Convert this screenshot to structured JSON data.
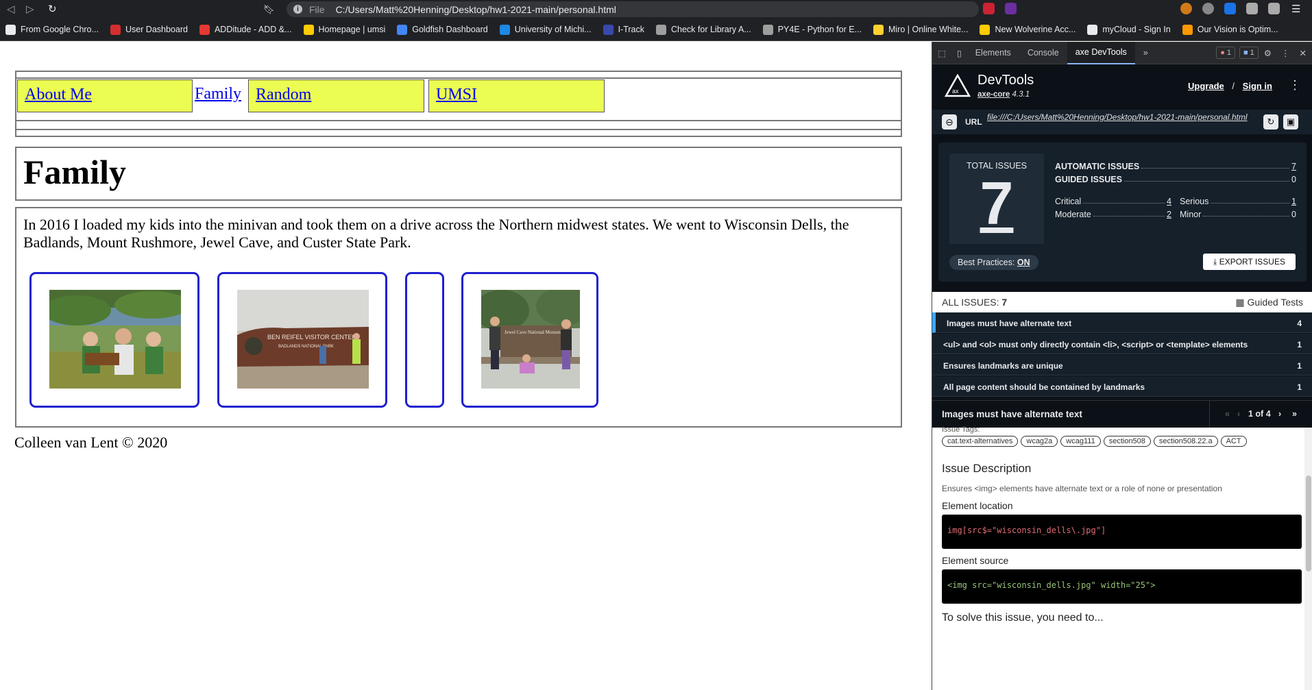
{
  "browser": {
    "address_scheme": "File",
    "address_path": "C:/Users/Matt%20Henning/Desktop/hw1-2021-main/personal.html",
    "bookmarks": [
      {
        "label": "From Google Chro...",
        "color": "#e8eaed"
      },
      {
        "label": "User Dashboard",
        "color": "#d32f2f"
      },
      {
        "label": "ADDitude - ADD &...",
        "color": "#e53935"
      },
      {
        "label": "Homepage | umsi",
        "color": "#ffcb05"
      },
      {
        "label": "Goldfish Dashboard",
        "color": "#4285f4"
      },
      {
        "label": "University of Michi...",
        "color": "#1e88e5"
      },
      {
        "label": "I-Track",
        "color": "#3949ab"
      },
      {
        "label": "Check for Library A...",
        "color": "#9e9e9e"
      },
      {
        "label": "PY4E - Python for E...",
        "color": "#9e9e9e"
      },
      {
        "label": "Miro | Online White...",
        "color": "#ffd02f"
      },
      {
        "label": "New Wolverine Acc...",
        "color": "#ffcb05"
      },
      {
        "label": "myCloud - Sign In",
        "color": "#e8eaed"
      },
      {
        "label": "Our Vision is Optim...",
        "color": "#ff9800"
      }
    ]
  },
  "page": {
    "nav": {
      "about": "About Me",
      "family": "Family",
      "random": "Random",
      "umsi": "UMSI"
    },
    "heading": "Family",
    "paragraph": "In 2016 I loaded my kids into the minivan and took them on a drive across the Northern midwest states. We went to Wisconsin Dells, the Badlands, Mount Rushmore, Jewel Cave, and Custer State Park.",
    "footer": "Colleen van Lent © 2020",
    "photo_sign_2": "BEN REIFEL VISITOR CENTER",
    "photo_sign_2b": "BADLANDS NATIONAL PARK",
    "photo_sign_4": "Jewel Cave National Monument"
  },
  "devtools": {
    "tabs": [
      "Elements",
      "Console",
      "axe DevTools"
    ],
    "error_count": "1",
    "message_count": "1",
    "title": "DevTools",
    "core_link": "axe-core",
    "core_version": "4.3.1",
    "upgrade": "Upgrade",
    "slash": "/",
    "sign_in": "Sign in",
    "url_label": "URL",
    "url_value": "file:///C:/Users/Matt%20Henning/Desktop/hw1-2021-main/personal.html",
    "total_issues_label": "TOTAL ISSUES",
    "total_issues": "7",
    "automatic_label": "AUTOMATIC ISSUES",
    "automatic": "7",
    "guided_label": "GUIDED ISSUES",
    "guided": "0",
    "critical_label": "Critical",
    "critical": "4",
    "serious_label": "Serious",
    "serious": "1",
    "moderate_label": "Moderate",
    "moderate": "2",
    "minor_label": "Minor",
    "minor": "0",
    "best_practices_label": "Best Practices:",
    "best_practices_state": "ON",
    "export": "EXPORT ISSUES",
    "all_issues_label": "ALL ISSUES:",
    "all_issues_count": "7",
    "guided_tests": "Guided Tests",
    "issues": [
      {
        "title": "Images must have alternate text",
        "count": "4"
      },
      {
        "title": "<ul> and <ol> must only directly contain <li>, <script> or <template> elements",
        "count": "1"
      },
      {
        "title": "Ensures landmarks are unique",
        "count": "1"
      },
      {
        "title": "All page content should be contained by landmarks",
        "count": "1"
      }
    ],
    "detail_title": "Images must have alternate text",
    "pager": "1 of 4",
    "issue_tags_label": "Issue Tags:",
    "tags": [
      "cat.text-alternatives",
      "wcag2a",
      "wcag111",
      "section508",
      "section508.22.a",
      "ACT"
    ],
    "issue_description_heading": "Issue Description",
    "issue_description": "Ensures <img> elements have alternate text or a role of none or presentation",
    "element_location_heading": "Element location",
    "element_location_code": "img[src$=\"wisconsin_dells\\.jpg\"]",
    "element_source_heading": "Element source",
    "element_source_code": "<img src=\"wisconsin_dells.jpg\" width=\"25\">",
    "solve_heading": "To solve this issue, you need to..."
  },
  "colors": {
    "nav_highlight": "#ebfc52",
    "photo_border": "#1f1fd0",
    "link": "#0000ee",
    "devtools_bg": "#0b1117"
  }
}
